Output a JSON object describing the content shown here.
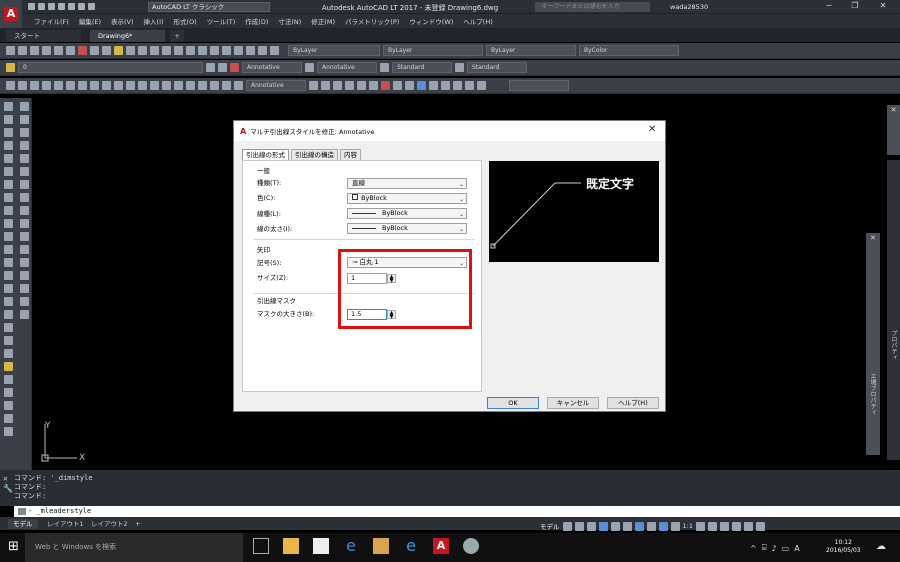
{
  "app": {
    "window_title": "Autodesk AutoCAD LT 2017 - 未登録    Drawing6.dwg",
    "workspace": "AutoCAD LT クラシック",
    "search_placeholder": "キーワードまたは語句を入力",
    "user": "wada28530",
    "logo_letter": "A",
    "logo_sub": "LT"
  },
  "menu": [
    "ファイル(F)",
    "編集(E)",
    "表示(V)",
    "挿入(I)",
    "形式(O)",
    "ツール(T)",
    "作成(D)",
    "寸法(N)",
    "修正(M)",
    "パラメトリック(P)",
    "ウィンドウ(W)",
    "ヘルプ(H)"
  ],
  "tabs": {
    "start": "スタート",
    "doc": "Drawing6*",
    "plus": "+"
  },
  "toolbar": {
    "layer": "0",
    "bylayer1": "ByLayer",
    "bylayer2": "ByLayer",
    "bylayer3": "ByLayer",
    "bycolor": "ByColor",
    "text_style": "Annotative",
    "dim_style": "Annotative",
    "table_style": "Standard",
    "mleader_style": "Standard",
    "mleader_combo": "Annotative"
  },
  "dialog": {
    "title": "マルチ引出線スタイルを修正: Annotative",
    "tabs": [
      "引出線の形式",
      "引出線の構造",
      "内容"
    ],
    "general": {
      "group": "一般",
      "type_label": "種類(T):",
      "type_value": "直線",
      "color_label": "色(C):",
      "color_value": "ByBlock",
      "linetype_label": "線種(L):",
      "linetype_value": "ByBlock",
      "lineweight_label": "線の太さ(I):",
      "lineweight_value": "ByBlock"
    },
    "arrow": {
      "group": "矢印",
      "symbol_label": "記号(S):",
      "symbol_value": "白丸 1",
      "size_label": "サイズ(Z):",
      "size_value": "1"
    },
    "mask": {
      "group": "引出線マスク",
      "size_label": "マスクの大きさ(B):",
      "size_value": "1.5"
    },
    "preview_text": "既定文字",
    "ok": "OK",
    "cancel": "キャンセル",
    "help": "ヘルプ(H)"
  },
  "command": {
    "history": [
      "コマンド:  '_dimstyle",
      "コマンド:",
      "コマンド:"
    ],
    "input": "- _mleaderstyle",
    "prompt_icon": "command-prompt-icon"
  },
  "layouts": [
    "モデル",
    "レイアウト1",
    "レイアウト2",
    "+"
  ],
  "status": {
    "model": "モデル",
    "scale": "1:1"
  },
  "palette_label": "プロパティ",
  "palette_label2": "エ場プロパティ",
  "ucs": {
    "x": "X",
    "y": "Y"
  },
  "taskbar": {
    "search": "Web と Windows を検索",
    "time": "10:12",
    "date": "2016/05/03",
    "ime": "A"
  },
  "colors": {
    "highlight": "#e01010",
    "brand": "#c4161c",
    "bg_dark": "#3b3f48"
  }
}
